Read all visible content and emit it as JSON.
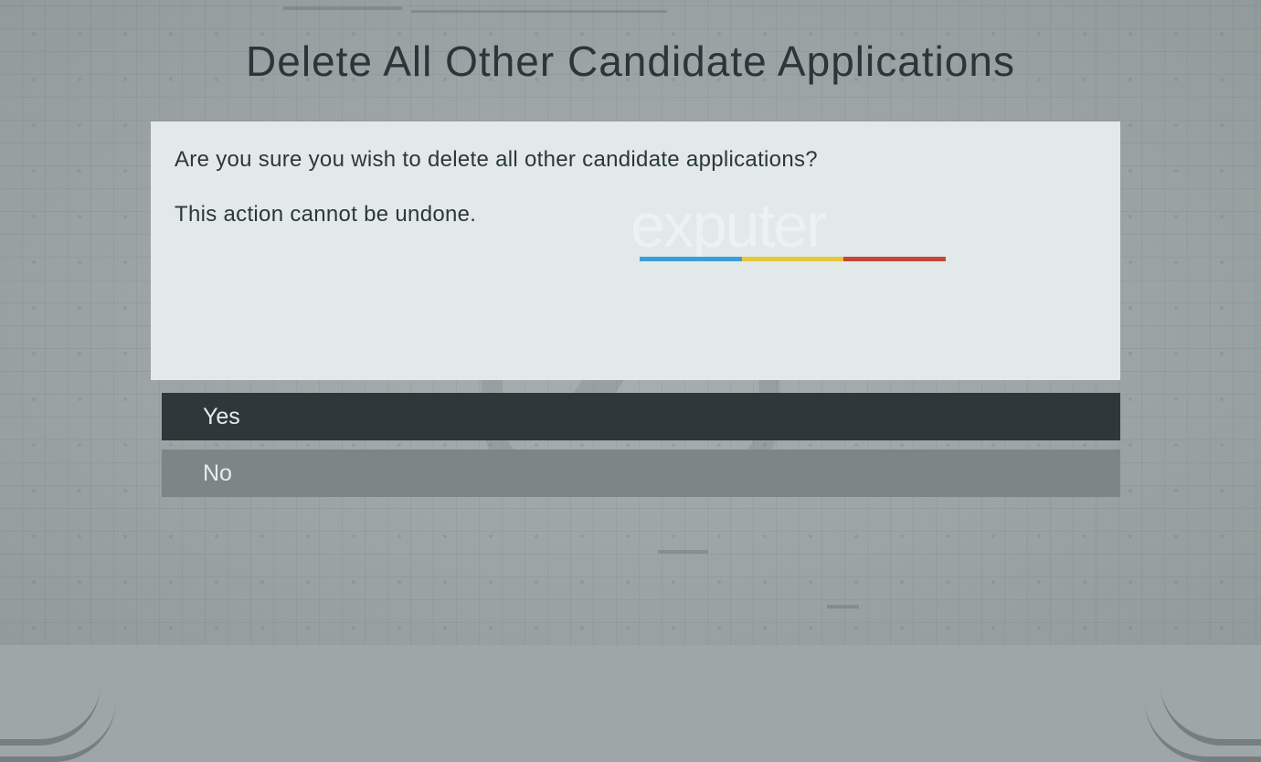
{
  "dialog": {
    "title": "Delete All Other Candidate Applications",
    "line1": "Are you sure you wish to delete all other candidate applications?",
    "line2": "This action cannot be undone."
  },
  "buttons": {
    "yes": "Yes",
    "no": "No"
  },
  "watermark": {
    "text": "exputer"
  }
}
